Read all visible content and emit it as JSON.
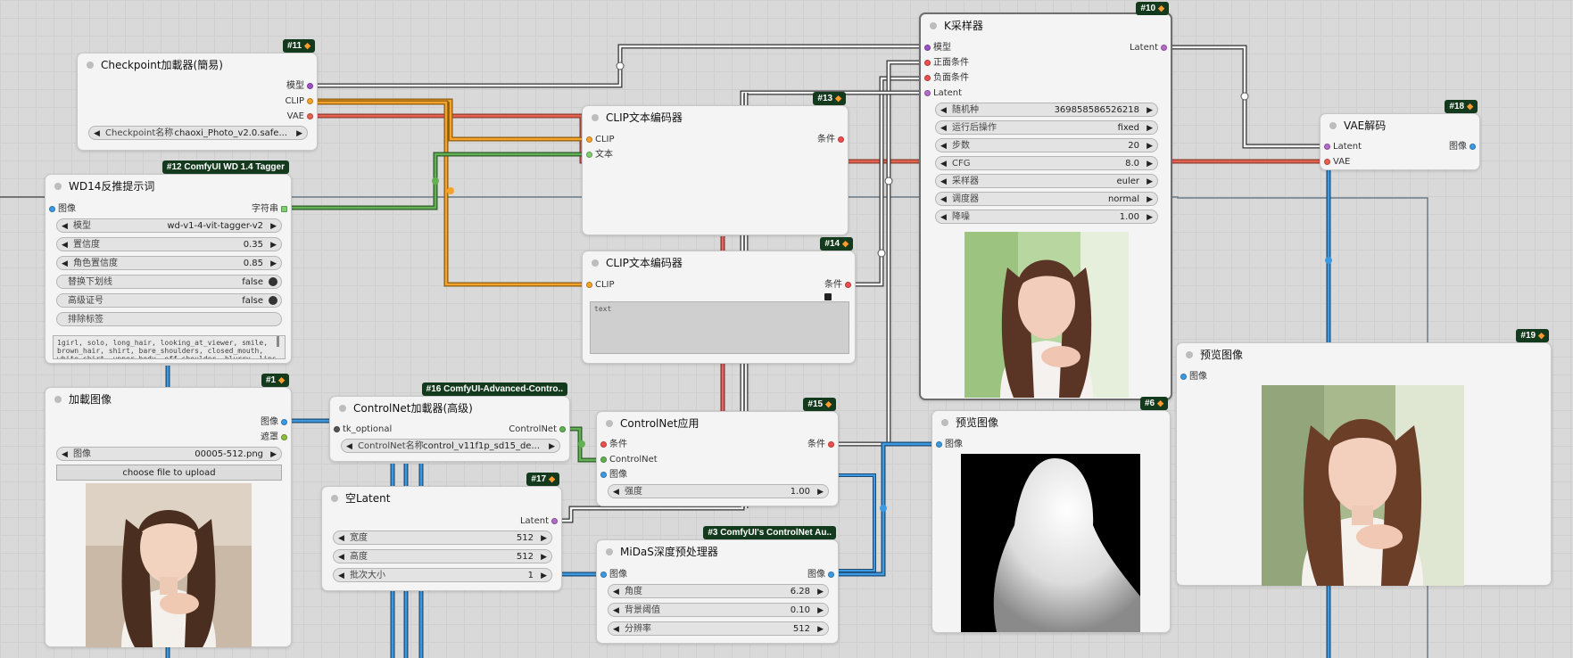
{
  "colors": {
    "clip": "#f6a32a",
    "model": "#9b52c5",
    "vae": "#e8614f",
    "conditioning": "#f04e4e",
    "image": "#3d9ae0",
    "controlnet": "#62b153",
    "latent": "#b46bc9",
    "string": "#7ecf6e",
    "mask": "#8cbf3a"
  },
  "badge_icon": "fox-icon",
  "nodes": {
    "ckpt": {
      "badge": "#11",
      "title": "Checkpoint加載器(簡易)",
      "outputs": [
        "模型",
        "CLIP",
        "VAE"
      ],
      "widget_label": "Checkpoint名称",
      "widget_value": "chaoxi_Photo_v2.0.safe..."
    },
    "wd14": {
      "badge": "#12 ComfyUI WD 1.4 Tagger",
      "title": "WD14反推提示词",
      "input": "图像",
      "output": "字符串",
      "widgets": [
        {
          "label": "模型",
          "value": "wd-v1-4-vit-tagger-v2"
        },
        {
          "label": "置信度",
          "value": "0.35"
        },
        {
          "label": "角色置信度",
          "value": "0.85"
        }
      ],
      "toggles": [
        {
          "label": "替换下划线",
          "value": "false"
        },
        {
          "label": "高级证号",
          "value": "false"
        }
      ],
      "exclude_label": "排除标签",
      "tags_text": "1girl, solo, long_hair, looking_at_viewer, smile, brown_hair, shirt, bare_shoulders, closed_mouth, white_shirt, upper_body, off_shoulder, blurry, lips"
    },
    "load": {
      "badge": "#1",
      "title": "加載图像",
      "outputs": [
        "图像",
        "遮罩"
      ],
      "widget_label": "图像",
      "widget_value": "00005-512.png",
      "upload_label": "choose file to upload"
    },
    "cnload": {
      "badge": "#16 ComfyUI-Advanced-Contro..",
      "title": "ControlNet加載器(高级)",
      "input": "tk_optional",
      "output": "ControlNet",
      "widget_label": "ControlNet名称",
      "widget_value": "control_v11f1p_sd15_de..."
    },
    "empty": {
      "badge": "#17",
      "title": "空Latent",
      "output": "Latent",
      "widgets": [
        {
          "label": "宽度",
          "value": "512"
        },
        {
          "label": "高度",
          "value": "512"
        },
        {
          "label": "批次大小",
          "value": "1"
        }
      ]
    },
    "clip13": {
      "badge": "#13",
      "title": "CLIP文本编码器",
      "inputs": [
        "CLIP",
        "文本"
      ],
      "output": "条件"
    },
    "clip14": {
      "badge": "#14",
      "title": "CLIP文本编码器",
      "input": "CLIP",
      "output": "条件",
      "text": "text"
    },
    "cnapply": {
      "badge": "#15",
      "title": "ControlNet应用",
      "inputs": [
        "条件",
        "ControlNet",
        "图像"
      ],
      "output": "条件",
      "widget_label": "强度",
      "widget_value": "1.00"
    },
    "midas": {
      "badge": "#3 ComfyUI's ControlNet Au..",
      "title": "MiDaS深度预处理器",
      "input": "图像",
      "output": "图像",
      "widgets": [
        {
          "label": "角度",
          "value": "6.28"
        },
        {
          "label": "背景阈值",
          "value": "0.10"
        },
        {
          "label": "分辨率",
          "value": "512"
        }
      ]
    },
    "ksampler": {
      "badge": "#10",
      "title": "K采样器",
      "inputs": [
        "模型",
        "正面条件",
        "负面条件",
        "Latent"
      ],
      "output": "Latent",
      "widgets": [
        {
          "label": "随机种",
          "value": "369858586526218"
        },
        {
          "label": "运行后操作",
          "value": "fixed"
        },
        {
          "label": "步数",
          "value": "20"
        },
        {
          "label": "CFG",
          "value": "8.0"
        },
        {
          "label": "采样器",
          "value": "euler"
        },
        {
          "label": "调度器",
          "value": "normal"
        },
        {
          "label": "降噪",
          "value": "1.00"
        }
      ]
    },
    "preview6": {
      "badge": "#6",
      "title": "预览图像",
      "input": "图像"
    },
    "vae": {
      "badge": "#18",
      "title": "VAE解码",
      "inputs": [
        "Latent",
        "VAE"
      ],
      "output": "图像"
    },
    "preview19": {
      "badge": "#19",
      "title": "预览图像",
      "input": "图像"
    }
  }
}
